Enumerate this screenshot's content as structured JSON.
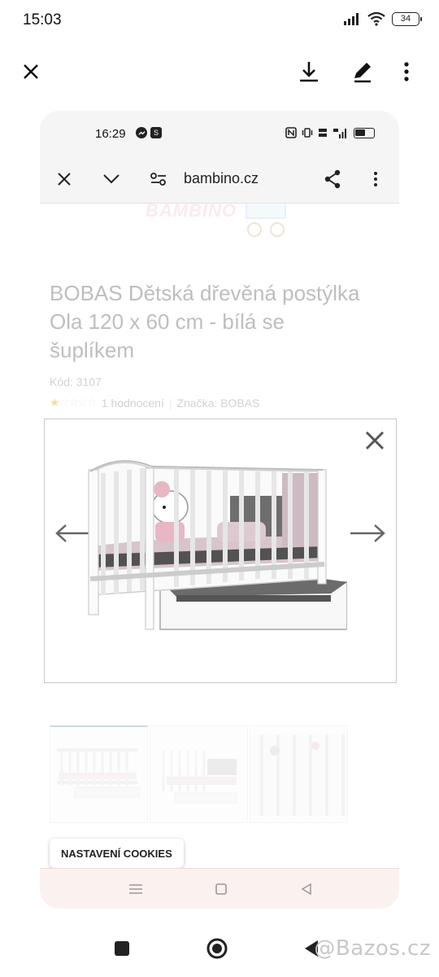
{
  "outer_status": {
    "time": "15:03",
    "battery": "34"
  },
  "outer_toolbar": {
    "close_icon": "close-icon",
    "download_icon": "download-icon",
    "edit_icon": "edit-icon",
    "more_icon": "more-vert-icon"
  },
  "inner_status": {
    "time": "16:29",
    "skype_badge": "S"
  },
  "browser": {
    "url": "bambino.cz"
  },
  "page": {
    "logo": "BAMBINO",
    "title": "BOBAS Dětská dřevěná postýlka Ola 120 x 60 cm - bílá se šuplíkem",
    "code": "Kód: 3107",
    "rating": {
      "stars_filled": 1,
      "stars_total": 5,
      "count_label": "1 hodnocení",
      "brand_label": "Značka: BOBAS"
    },
    "thumbnails": [
      {
        "name": "crib-side-view"
      },
      {
        "name": "crib-with-drawer-angle"
      },
      {
        "name": "crib-detail-bars"
      }
    ],
    "cookie_button": "NASTAVENÍ COOKIES"
  },
  "lightbox": {
    "image": "white wooden crib with drawer and pink bedding"
  },
  "watermark": "@Bazos.cz",
  "colors": {
    "accent": "#7a9ac2",
    "star": "#e5a200",
    "card_bg": "#f7f7f7"
  }
}
